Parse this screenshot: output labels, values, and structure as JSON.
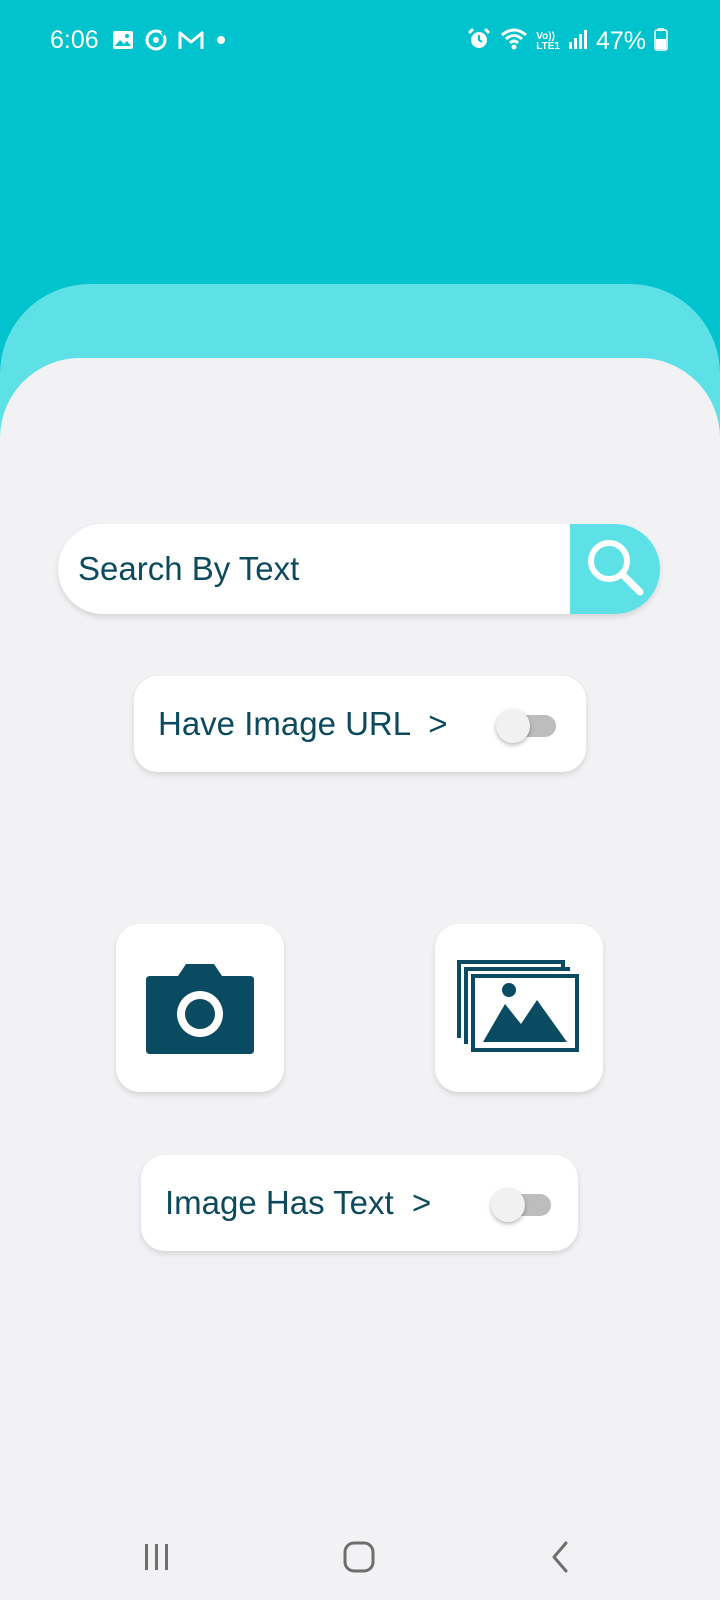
{
  "status_bar": {
    "time": "6:06",
    "notification_icons": [
      "gallery-icon",
      "sync-icon",
      "gmail-icon",
      "dot-icon"
    ],
    "system_icons": [
      "alarm-icon",
      "wifi-icon",
      "volte-icon",
      "signal-icon",
      "battery-icon"
    ],
    "volte_text": "Vo))",
    "lte_text": "LTE1",
    "battery_percent": "47%"
  },
  "search": {
    "placeholder": "Search By Text",
    "button_icon": "search-icon"
  },
  "image_url_toggle": {
    "label": "Have Image URL  >",
    "enabled": false
  },
  "image_sources": [
    {
      "name": "camera",
      "icon": "camera-icon"
    },
    {
      "name": "gallery",
      "icon": "gallery-icon"
    }
  ],
  "image_text_toggle": {
    "label": "Image Has Text  >",
    "enabled": false
  },
  "nav_bar": {
    "buttons": [
      "recents-icon",
      "home-icon",
      "back-icon"
    ]
  },
  "colors": {
    "header": "#00c3cd",
    "accent": "#5de1e6",
    "background": "#f2f2f4",
    "primary_text": "#0d4a5e"
  }
}
